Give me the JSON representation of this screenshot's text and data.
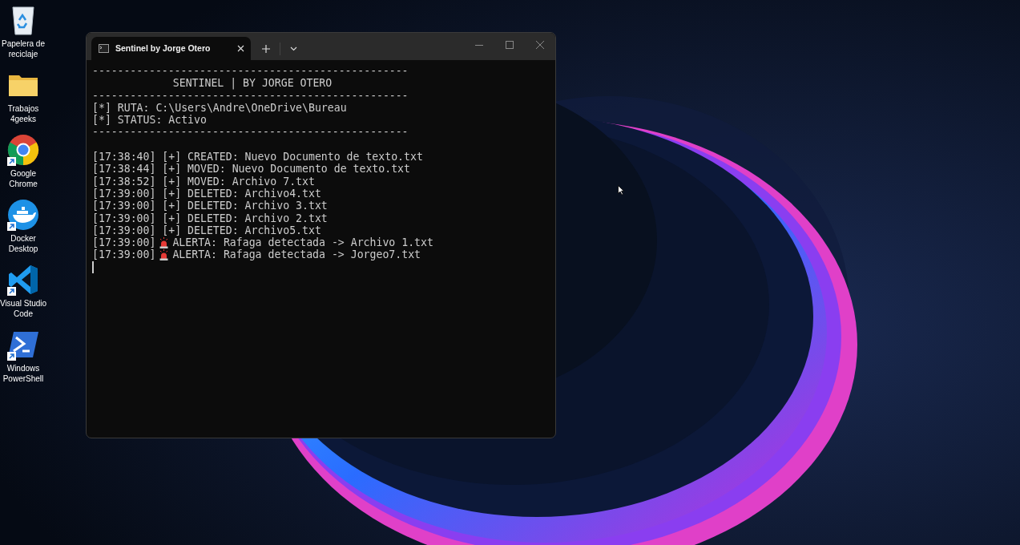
{
  "desktop_icons": [
    {
      "kind": "recycle",
      "label": "Papelera de reciclaje",
      "shortcut": false
    },
    {
      "kind": "folder",
      "label": "Trabajos 4geeks",
      "shortcut": false
    },
    {
      "kind": "chrome",
      "label": "Google Chrome",
      "shortcut": true
    },
    {
      "kind": "docker",
      "label": "Docker Desktop",
      "shortcut": true
    },
    {
      "kind": "vscode",
      "label": "Visual Studio Code",
      "shortcut": true
    },
    {
      "kind": "powershell",
      "label": "Windows PowerShell",
      "shortcut": true
    }
  ],
  "window": {
    "tabs": [
      {
        "title": "Sentinel by Jorge Otero",
        "selected": true
      }
    ],
    "lines": [
      {
        "kind": "rule",
        "text": "--------------------------------------------------"
      },
      {
        "kind": "heading",
        "text": "SENTINEL | BY JORGE OTERO"
      },
      {
        "kind": "rule",
        "text": "--------------------------------------------------"
      },
      {
        "kind": "text",
        "text": "[*] RUTA: C:\\Users\\Andre\\OneDrive\\Bureau"
      },
      {
        "kind": "text",
        "text": "[*] STATUS: Activo"
      },
      {
        "kind": "rule",
        "text": "--------------------------------------------------"
      },
      {
        "kind": "blank"
      },
      {
        "kind": "text",
        "text": "[17:38:40] [+] CREATED: Nuevo Documento de texto.txt"
      },
      {
        "kind": "text",
        "text": "[17:38:44] [+] MOVED: Nuevo Documento de texto.txt"
      },
      {
        "kind": "text",
        "text": "[17:38:52] [+] MOVED: Archivo 7.txt"
      },
      {
        "kind": "text",
        "text": "[17:39:00] [+] DELETED: Archivo4.txt"
      },
      {
        "kind": "text",
        "text": "[17:39:00] [+] DELETED: Archivo 3.txt"
      },
      {
        "kind": "text",
        "text": "[17:39:00] [+] DELETED: Archivo 2.txt"
      },
      {
        "kind": "text",
        "text": "[17:39:00] [+] DELETED: Archivo5.txt"
      },
      {
        "kind": "alert",
        "time": "[17:39:00]",
        "text": "ALERTA: Rafaga detectada -> Archivo 1.txt"
      },
      {
        "kind": "alert",
        "time": "[17:39:00]",
        "text": "ALERTA: Rafaga detectada -> Jorgeo7.txt"
      }
    ]
  }
}
